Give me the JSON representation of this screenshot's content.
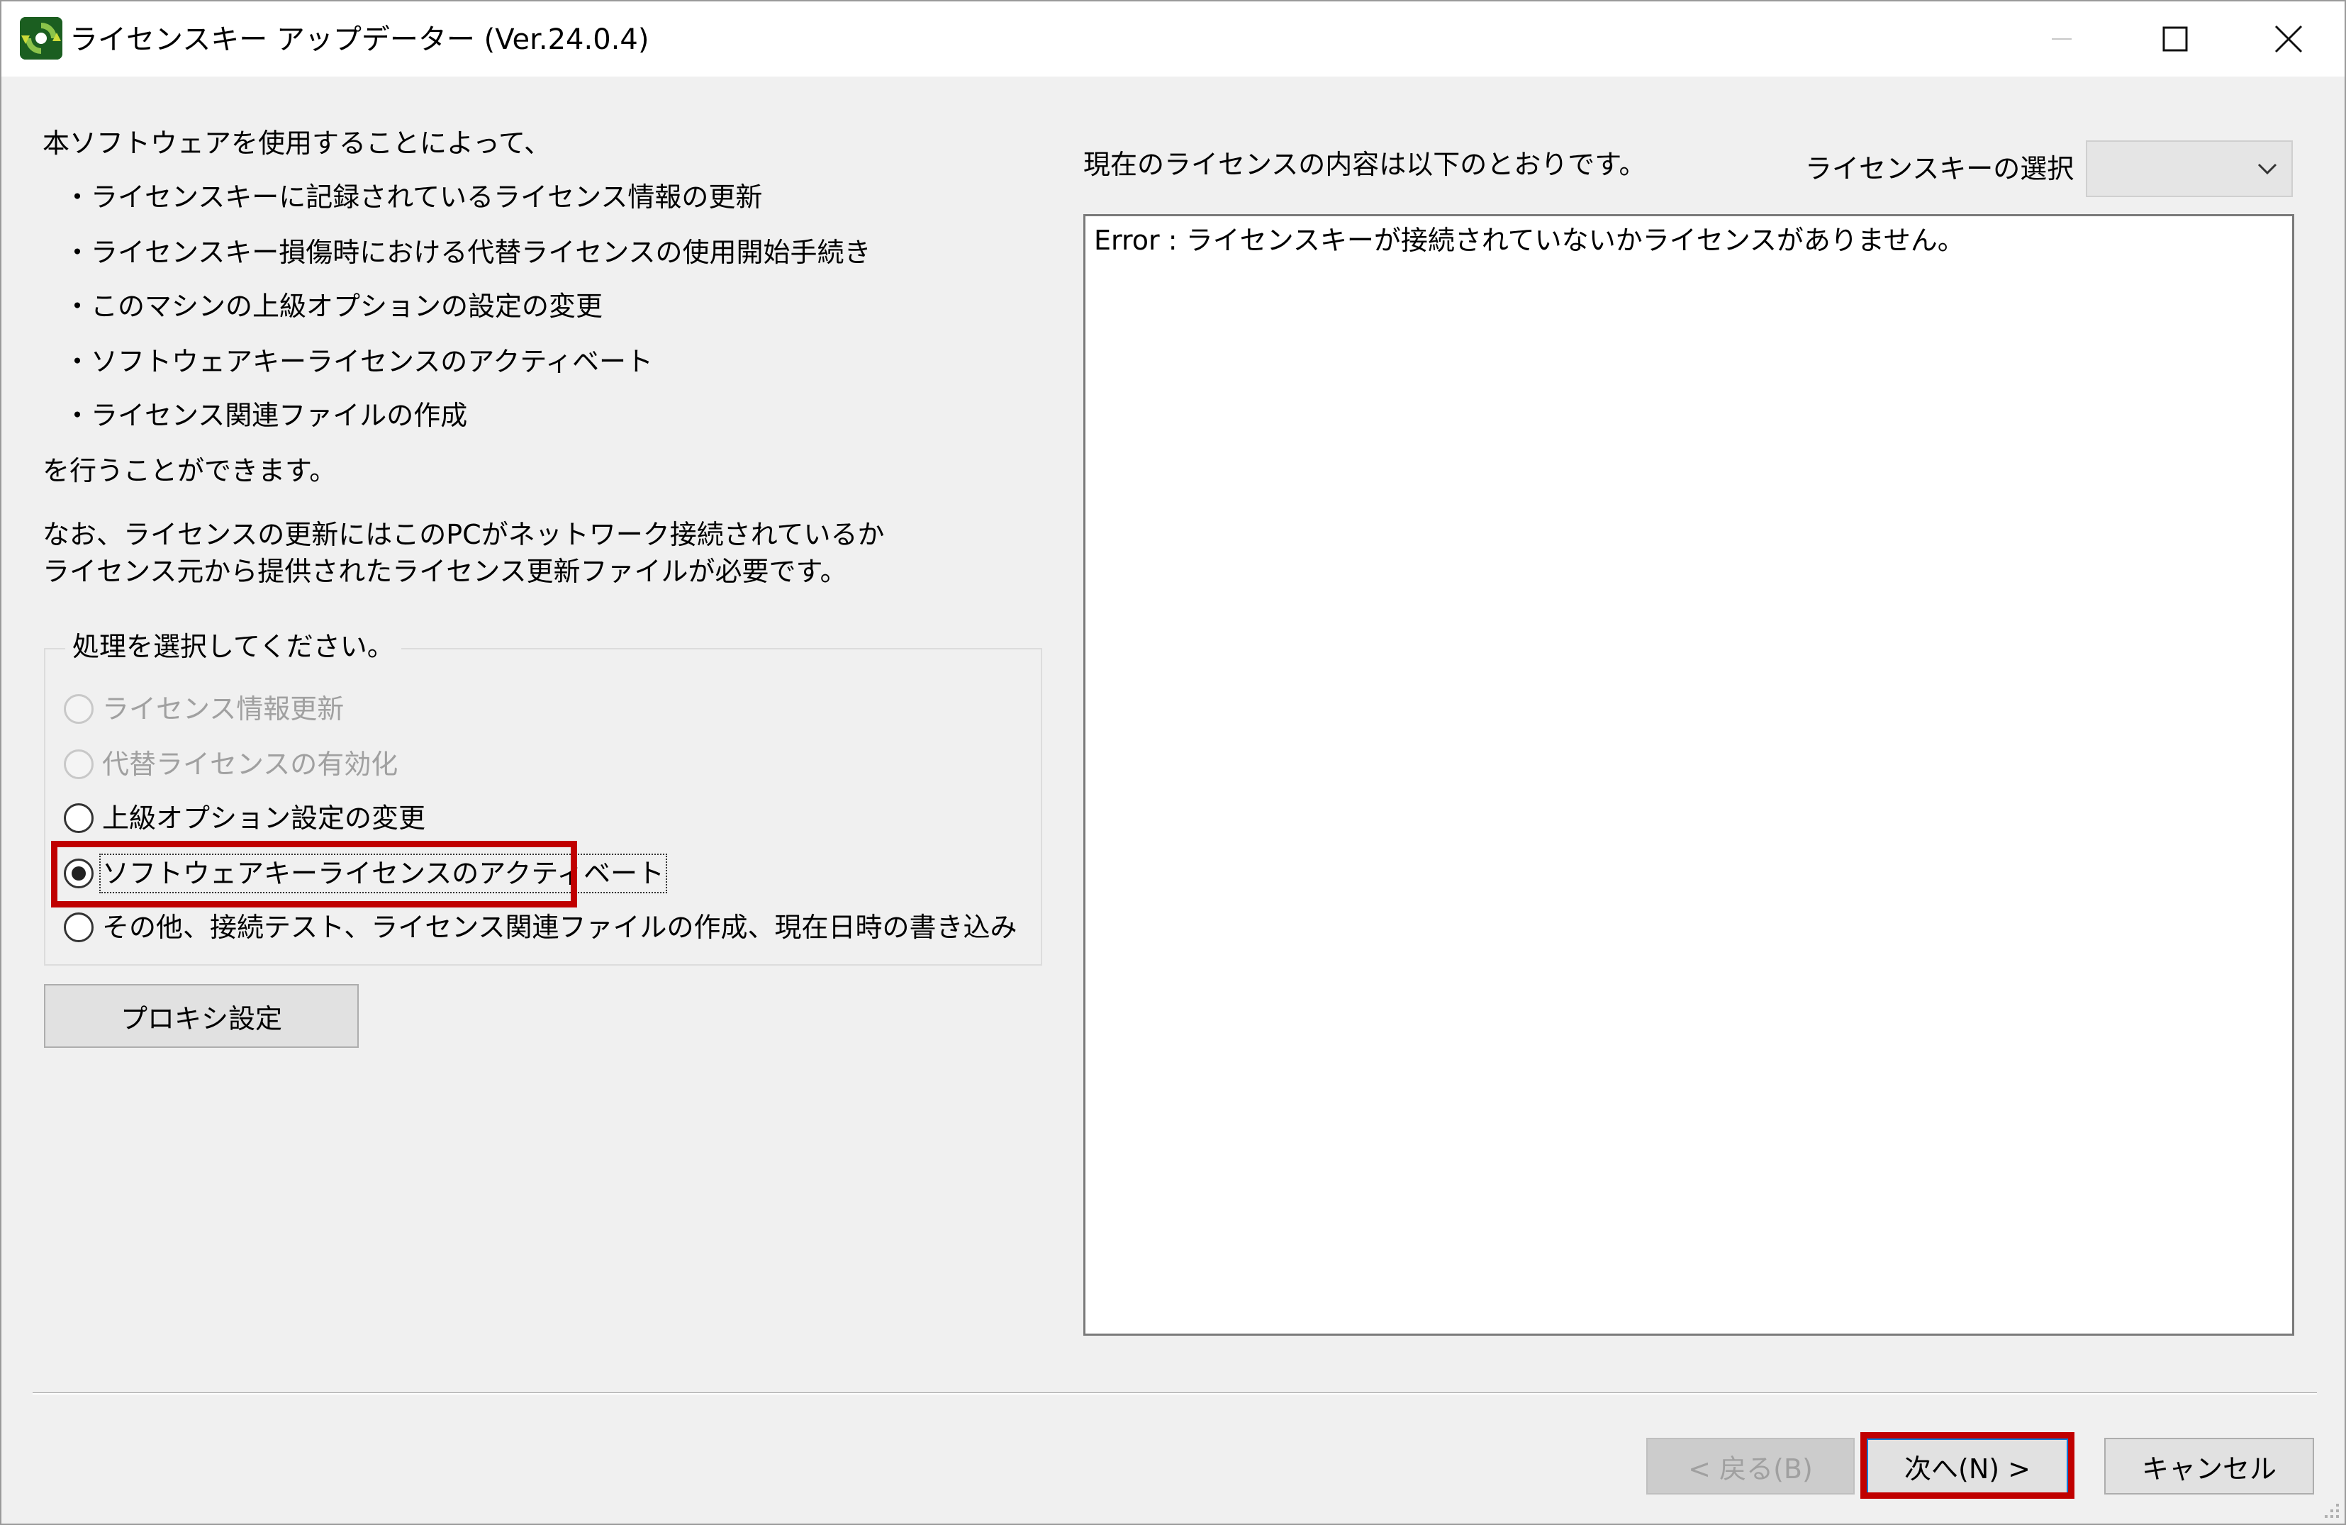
{
  "window": {
    "title": "ライセンスキー アップデーター (Ver.24.0.4)",
    "icon": "updater-app-icon",
    "controls": [
      "minimize-icon",
      "maximize-icon",
      "close-icon"
    ]
  },
  "intro": {
    "line1": "本ソフトウェアを使用することによって、",
    "bullets": [
      "・ライセンスキーに記録されているライセンス情報の更新",
      "・ライセンスキー損傷時における代替ライセンスの使用開始手続き",
      "・このマシンの上級オプションの設定の変更",
      "・ソフトウェアキーライセンスのアクティベート",
      "・ライセンス関連ファイルの作成"
    ],
    "line_end": "を行うことができます。",
    "note1": "なお、ライセンスの更新にはこのPCがネットワーク接続されているか",
    "note2": "ライセンス元から提供されたライセンス更新ファイルが必要です。"
  },
  "process_group": {
    "legend": "処理を選択してください。",
    "options": [
      {
        "label": "ライセンス情報更新",
        "enabled": false,
        "checked": false
      },
      {
        "label": "代替ライセンスの有効化",
        "enabled": false,
        "checked": false
      },
      {
        "label": "上級オプション設定の変更",
        "enabled": true,
        "checked": false
      },
      {
        "label": "ソフトウェアキーライセンスのアクティベート",
        "enabled": true,
        "checked": true
      },
      {
        "label": "その他、接続テスト、ライセンス関連ファイルの作成、現在日時の書き込み",
        "enabled": true,
        "checked": false
      }
    ]
  },
  "proxy_button": "プロキシ設定",
  "license_info": {
    "heading": "現在のライセンスの内容は以下のとおりです。",
    "select_label": "ライセンスキーの選択",
    "select_value": "",
    "content": "Error : ライセンスキーが接続されていないかライセンスがありません。"
  },
  "footer": {
    "back": "< 戻る(B)",
    "next": "次へ(N) >",
    "cancel": "キャンセル"
  },
  "colors": {
    "highlight": "#c00000",
    "window_bg": "#f0f0f0",
    "focus_border": "#0078d7"
  }
}
